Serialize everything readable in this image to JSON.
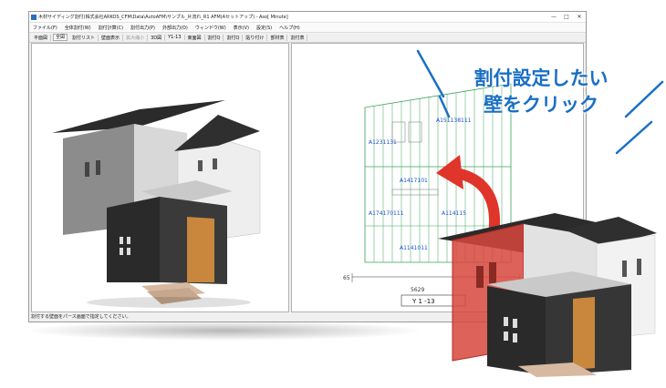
{
  "window": {
    "title": "木材サイディング割付(株式会社ARKOS_CFM\\Data\\AutoAFM\\サンプル_片流れ_R1 AFM(Aセットアップ) - Aso[ Minute]",
    "controls": [
      "—",
      "□",
      "✕"
    ]
  },
  "menu": [
    "ファイル(F)",
    "全体割付(W)",
    "割付計算(C)",
    "割付出力(P)",
    "外部出力(O)",
    "ウィンドウ(W)",
    "表示(V)",
    "設定(S)",
    "ヘルプ(H)"
  ],
  "toolbar": {
    "items": [
      "平面図",
      "割付リスト",
      "壁面表示",
      "3D図",
      "Y1-13",
      "東面図",
      "割付Q",
      "割付Q",
      "貼り付け",
      "部材表",
      "割付表"
    ],
    "field_value": "全図",
    "dim_item": "拡大縮小"
  },
  "drawing": {
    "labels": [
      "A151138111",
      "A1231131",
      "A1417101",
      "A174170111",
      "A114115",
      "A1141011"
    ],
    "dimension": "5629",
    "dim_left": "65",
    "view_label": "Y 1 -13"
  },
  "status": {
    "text": "割付する壁面をパース画面で指定してください。"
  },
  "callout": {
    "line1": "割付設定したい",
    "line2": "壁をクリック",
    "color": "#1a6fc4"
  },
  "colors": {
    "wall_highlight": "#d7463c",
    "dark_wall": "#2a2a2a",
    "door_wood": "#c8873d",
    "grid_green": "#3aa45a",
    "label_blue": "#1f4fc9",
    "arrow_red": "#e0352a"
  }
}
